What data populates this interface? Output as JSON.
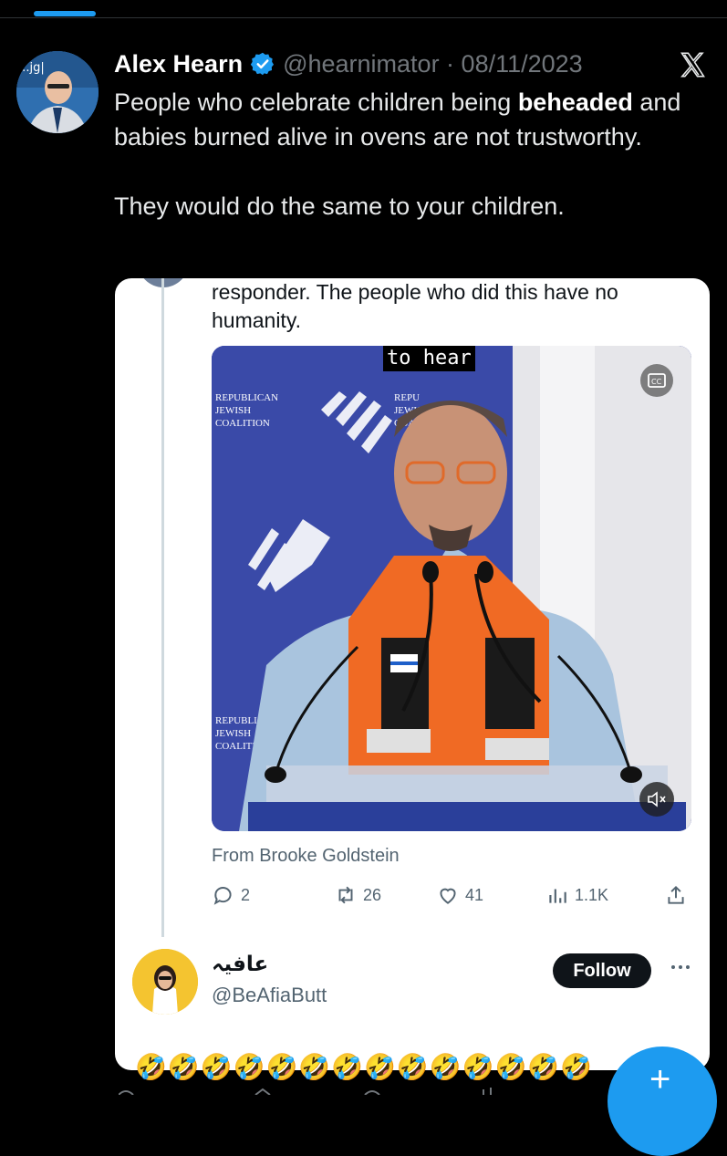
{
  "tweet": {
    "author_name": "Alex Hearn",
    "handle_date": "@hearnimator · 08/11/2023",
    "text_pre": "People who celebrate children being ",
    "text_bold": "beheaded",
    "text_post": " and babies burned alive in ovens are not trustworthy.",
    "text_second": "They would do the same to your children.",
    "avatar_icon": "profile-photo",
    "verified_icon": "verified-badge-icon",
    "source_icon": "x-logo-icon"
  },
  "embedded": {
    "text": "responder. The people who did this have no humanity.",
    "video": {
      "caption": "to hear",
      "cc_icon": "closed-captions-icon",
      "mute_icon": "muted-speaker-icon"
    },
    "attribution": "From Brooke Goldstein",
    "actions": {
      "replies": "2",
      "reposts": "26",
      "likes": "41",
      "views": "1.1K"
    }
  },
  "reply": {
    "name": "عافيہ",
    "handle": "@BeAfiaButt",
    "follow_label": "Follow",
    "emojis": "🤣🤣🤣🤣🤣🤣🤣🤣🤣🤣🤣🤣🤣🤣"
  },
  "colors": {
    "background": "#000000",
    "accent": "#1d9bf0",
    "card": "#ffffff",
    "muted": "#71767b"
  }
}
